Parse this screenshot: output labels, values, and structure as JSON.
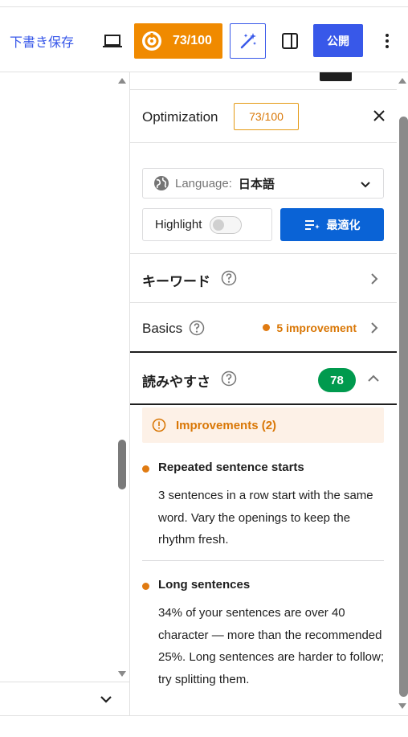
{
  "toolbar": {
    "draft_label": "下書き保存",
    "score_label": "73/100",
    "publish_label": "公開",
    "icons": [
      "laptop-icon",
      "seo-score-icon",
      "ai-wand-icon",
      "sidebar-panel-icon",
      "more-vertical-icon"
    ],
    "colors": {
      "score_bg": "#f08a00",
      "accent": "#3858e9"
    }
  },
  "sidebar": {
    "title": "Optimization",
    "score_badge": "73/100",
    "language": {
      "label": "Language:",
      "value": "日本語"
    },
    "highlight": {
      "label": "Highlight",
      "enabled": false
    },
    "optimize_label": "最適化",
    "sections": {
      "keyword": {
        "title": "キーワード"
      },
      "basics": {
        "title": "Basics",
        "status": "5 improvement"
      },
      "readability": {
        "title": "読みやすさ",
        "score": "78",
        "expanded": true
      }
    },
    "improvements": {
      "header": "Improvements (2)",
      "items": [
        {
          "title": "Repeated sentence starts",
          "description": "3 sentences in a row start with the same word. Vary the openings to keep the rhythm fresh."
        },
        {
          "title": "Long sentences",
          "description": "34% of your sentences are over 40 character — more than the recommended 25%. Long sentences are harder to follow; try splitting them."
        }
      ]
    },
    "colors": {
      "warning": "#d97706",
      "good": "#009a4e",
      "primary": "#0a63d6"
    }
  }
}
